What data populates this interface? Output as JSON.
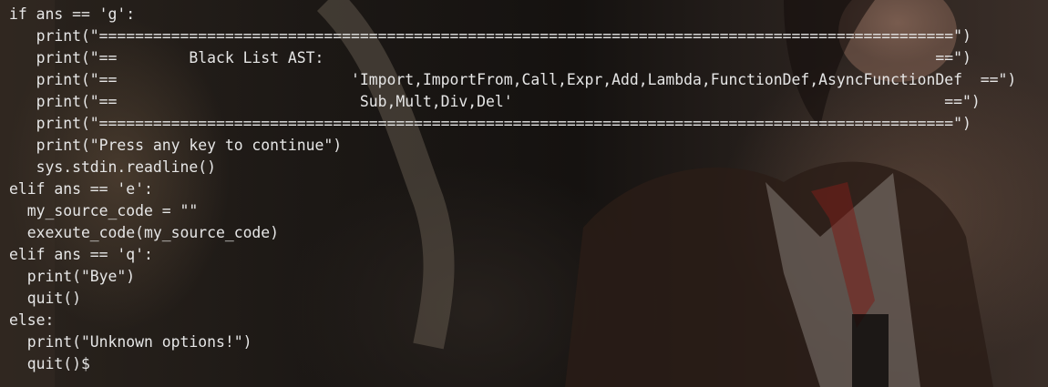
{
  "terminal": {
    "lines": [
      "if ans == 'g':",
      "   print(\"===============================================================================================\")",
      "   print(\"==        Black List AST:                                                                    ==\")",
      "   print(\"==                          'Import,ImportFrom,Call,Expr,Add,Lambda,FunctionDef,AsyncFunctionDef  ==\")",
      "   print(\"==                           Sub,Mult,Div,Del'                                                ==\")",
      "   print(\"===============================================================================================\")",
      "   print(\"Press any key to continue\")",
      "   sys.stdin.readline()",
      "elif ans == 'e':",
      "  my_source_code = \"\"",
      "  exexute_code(my_source_code)",
      "elif ans == 'q':",
      "  print(\"Bye\")",
      "  quit()",
      "else:",
      "  print(\"Unknown options!\")",
      "  quit()$"
    ]
  }
}
